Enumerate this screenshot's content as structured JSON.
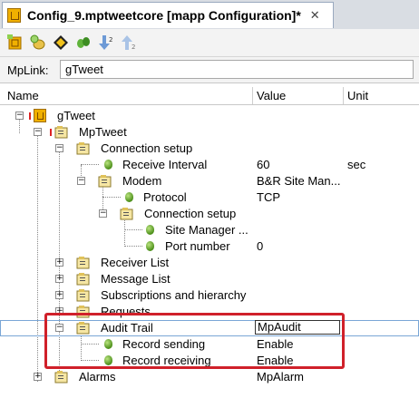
{
  "tab": {
    "title": "Config_9.mptweetcore [mapp Configuration]*",
    "close": "✕"
  },
  "toolbar": {
    "icons": [
      "new-config-icon",
      "add-icon",
      "navigate-icon",
      "link-icon",
      "sort-descending-icon",
      "sort-ascending-icon"
    ]
  },
  "mplink": {
    "label": "MpLink:",
    "value": "gTweet"
  },
  "columns": {
    "name": "Name",
    "value": "Value",
    "unit": "Unit"
  },
  "tree": {
    "gtweet": {
      "name": "gTweet"
    },
    "mptweet": {
      "name": "MpTweet"
    },
    "connection_setup": {
      "name": "Connection setup"
    },
    "receive_interval": {
      "name": "Receive Interval",
      "value": "60",
      "unit": "sec"
    },
    "modem": {
      "name": "Modem",
      "value": "B&R Site Man..."
    },
    "protocol": {
      "name": "Protocol",
      "value": "TCP"
    },
    "modem_connection_setup": {
      "name": "Connection setup"
    },
    "site_manager": {
      "name": "Site Manager ..."
    },
    "port_number": {
      "name": "Port number",
      "value": "0"
    },
    "receiver_list": {
      "name": "Receiver List"
    },
    "message_list": {
      "name": "Message List"
    },
    "subscriptions": {
      "name": "Subscriptions and hierarchy"
    },
    "requests": {
      "name": "Requests"
    },
    "audit_trail": {
      "name": "Audit Trail",
      "value": "MpAudit"
    },
    "record_sending": {
      "name": "Record sending",
      "value": "Enable"
    },
    "record_receiving": {
      "name": "Record receiving",
      "value": "Enable"
    },
    "alarms": {
      "name": "Alarms",
      "value": "MpAlarm"
    }
  },
  "colors": {
    "highlight_box": "#d0202a",
    "selection_outline": "#7aa6d6"
  }
}
